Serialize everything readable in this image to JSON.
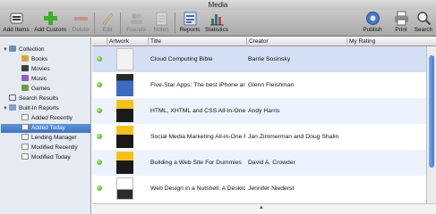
{
  "window": {
    "title": "Media"
  },
  "toolbar": {
    "add_items": "Add Items",
    "add_custom": "Add Custom",
    "delete": "Delete",
    "edit": "Edit",
    "friends": "Friends",
    "notes": "Notes",
    "reports": "Reports",
    "statistics": "Statistics",
    "publish": "Publish",
    "print": "Print",
    "search": "Search"
  },
  "sidebar": {
    "collection": "Collection",
    "books": "Books",
    "movies": "Movies",
    "music": "Music",
    "games": "Games",
    "search_results": "Search Results",
    "built_in_reports": "Built-In Reports",
    "added_recently": "Added Recently",
    "added_today": "Added Today",
    "lending_manager": "Lending Manager",
    "modified_recently": "Modified Recently",
    "modified_today": "Modified Today"
  },
  "table": {
    "columns": {
      "artwork": "Artwork",
      "title": "Title",
      "creator": "Creator",
      "rating": "My Rating"
    },
    "rows": [
      {
        "title": "Cloud Computing Bible",
        "creator": "Barrie Sosinsky"
      },
      {
        "title": "Five-Star Apps: The best iPhone and i...",
        "creator": "Glenn Fleishman"
      },
      {
        "title": "HTML, XHTML and CSS All-In-One Fo...",
        "creator": "Andy Harris"
      },
      {
        "title": "Social Media Marketing All-in-One Fo...",
        "creator": "Jan Zimmerman and Doug Shalin"
      },
      {
        "title": "Building a Web Site For Dummies",
        "creator": "David A. Crowder"
      },
      {
        "title": "Web Design in a Nutshell: A Desktop ...",
        "creator": "Jennifer Niederst"
      }
    ]
  },
  "colors": {
    "selection": "#3e74c3",
    "row_alt": "#edf3fe",
    "sidebar_bg": "#e6ebf2",
    "status_dot": "#3e9b19"
  }
}
